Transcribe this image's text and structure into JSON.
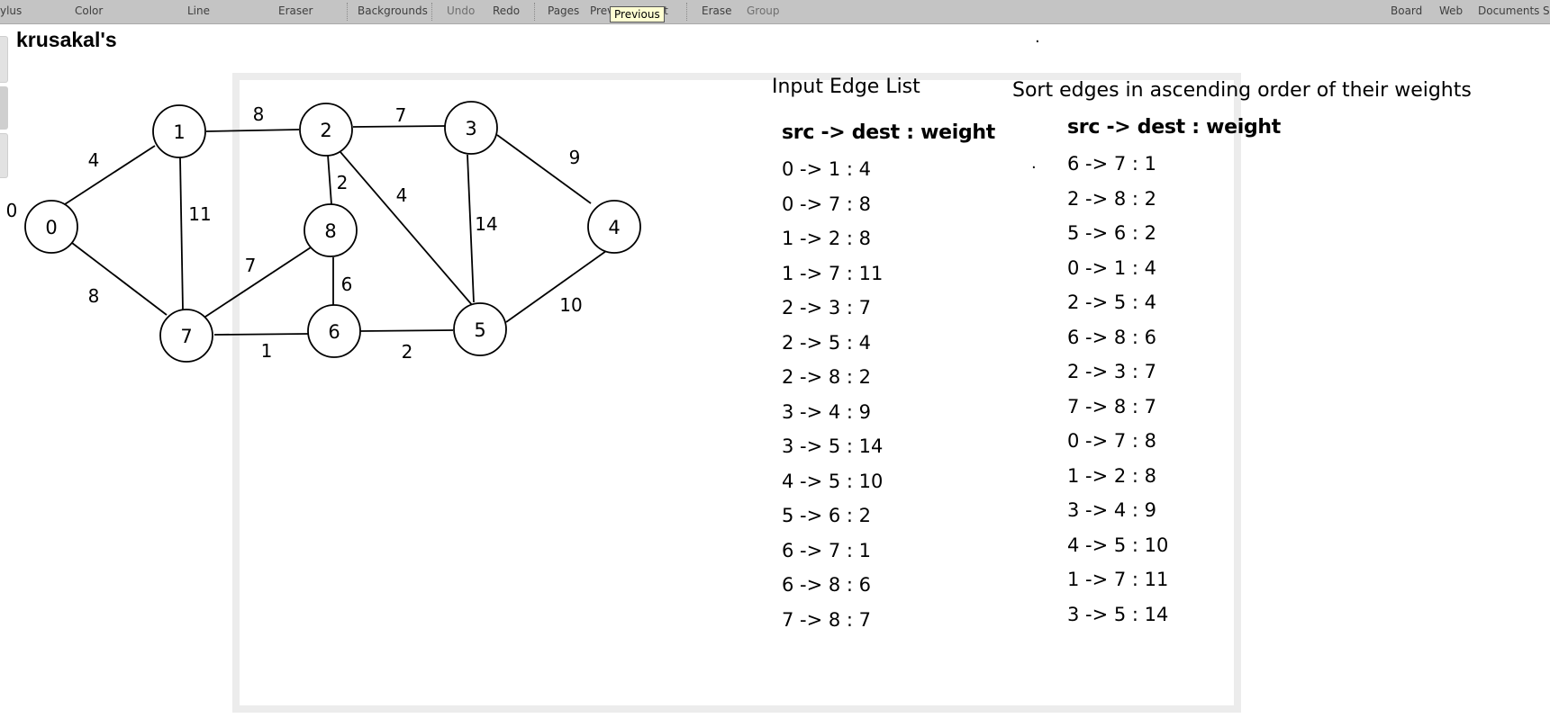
{
  "toolbar": {
    "items": {
      "stylus": "ylus",
      "color": "Color",
      "line": "Line",
      "eraser": "Eraser",
      "backgrounds": "Backgrounds",
      "undo": "Undo",
      "redo": "Redo",
      "pages": "Pages",
      "previous": "Prev",
      "next": "xt",
      "erase": "Erase",
      "group": "Group",
      "board": "Board",
      "web": "Web",
      "documents": "Documents",
      "settings": "S"
    },
    "tooltip": "Previous"
  },
  "board": {
    "title": "krusakal's",
    "graph": {
      "edges": [
        {
          "from": "0",
          "to": "1",
          "weight": "4"
        },
        {
          "from": "0",
          "to": "7",
          "weight": "8"
        },
        {
          "from": "1",
          "to": "2",
          "weight": "8"
        },
        {
          "from": "1",
          "to": "7",
          "weight": "11"
        },
        {
          "from": "2",
          "to": "3",
          "weight": "7"
        },
        {
          "from": "2",
          "to": "5",
          "weight": "4"
        },
        {
          "from": "2",
          "to": "8",
          "weight": "2"
        },
        {
          "from": "3",
          "to": "4",
          "weight": "9"
        },
        {
          "from": "3",
          "to": "5",
          "weight": "14"
        },
        {
          "from": "4",
          "to": "5",
          "weight": "10"
        },
        {
          "from": "5",
          "to": "6",
          "weight": "2"
        },
        {
          "from": "6",
          "to": "7",
          "weight": "1"
        },
        {
          "from": "6",
          "to": "8",
          "weight": "6"
        },
        {
          "from": "7",
          "to": "8",
          "weight": "7"
        }
      ],
      "stray_label": "0"
    },
    "input_list": {
      "heading": "Input Edge List",
      "column_header": "src -> dest : weight",
      "rows": [
        "0 -> 1 : 4",
        "0 -> 7 : 8",
        "1 -> 2 : 8",
        "1 -> 7 : 11",
        "2 -> 3 : 7",
        "2 -> 5 : 4",
        "2 -> 8 : 2",
        "3 -> 4 : 9",
        "3 -> 5 : 14",
        "4 -> 5 : 10",
        "5 -> 6 : 2",
        "6 -> 7 : 1",
        "6 -> 8 : 6",
        "7 -> 8 : 7"
      ]
    },
    "sorted_list": {
      "heading": "Sort edges in ascending order of their weights",
      "column_header": "src -> dest : weight",
      "rows": [
        "6 -> 7 : 1",
        "2 -> 8 : 2",
        "5 -> 6 : 2",
        "0 -> 1 : 4",
        "2 -> 5 : 4",
        "6 -> 8 : 6",
        "2 -> 3 : 7",
        "7 -> 8 : 7",
        "0 -> 7 : 8",
        "1 -> 2 : 8",
        "3 -> 4 : 9",
        "4 -> 5 : 10",
        "1 -> 7 : 11",
        "3 -> 5 : 14"
      ]
    }
  }
}
